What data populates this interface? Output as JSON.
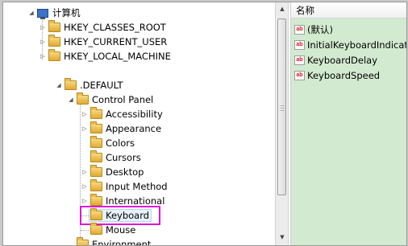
{
  "tree": {
    "root": "计算机",
    "hives": [
      "HKEY_CLASSES_ROOT",
      "HKEY_CURRENT_USER",
      "HKEY_LOCAL_MACHINE"
    ],
    "default_key": ".DEFAULT",
    "control_panel": "Control Panel",
    "children": [
      "Accessibility",
      "Appearance",
      "Colors",
      "Cursors",
      "Desktop",
      "Input Method",
      "International",
      "Keyboard",
      "Mouse"
    ],
    "next_item": "Environment",
    "selected": "Keyboard"
  },
  "values_pane": {
    "column_header": "名称",
    "items": [
      "(默认)",
      "InitialKeyboardIndicators",
      "KeyboardDelay",
      "KeyboardSpeed"
    ]
  },
  "colors": {
    "highlight_border": "#e016d8",
    "values_background": "#d2ead0"
  },
  "icons": {
    "folder": "folder-icon",
    "computer": "computer-icon",
    "value": "string-value-icon"
  }
}
